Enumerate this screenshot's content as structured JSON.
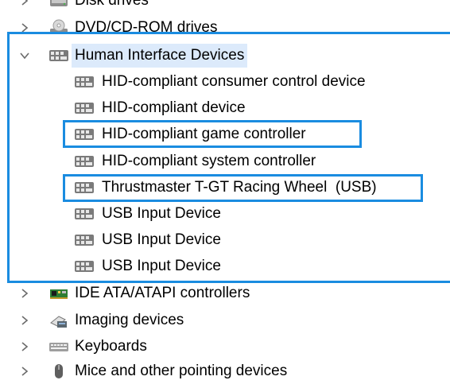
{
  "tree": {
    "items": [
      {
        "label": "Disk drives",
        "icon": "disk-drive-icon",
        "expanded": false
      },
      {
        "label": "DVD/CD-ROM drives",
        "icon": "dvd-drive-icon",
        "expanded": false
      },
      {
        "label": "Human Interface Devices",
        "icon": "hid-device-icon",
        "expanded": true,
        "selected": true
      },
      {
        "label": "HID-compliant consumer control device",
        "icon": "hid-device-icon"
      },
      {
        "label": "HID-compliant device",
        "icon": "hid-device-icon"
      },
      {
        "label": "HID-compliant game controller",
        "icon": "hid-device-icon",
        "highlighted": true
      },
      {
        "label": "HID-compliant system controller",
        "icon": "hid-device-icon"
      },
      {
        "label": "Thrustmaster T-GT Racing Wheel  (USB)",
        "icon": "hid-device-icon",
        "highlighted": true
      },
      {
        "label": "USB Input Device",
        "icon": "hid-device-icon"
      },
      {
        "label": "USB Input Device",
        "icon": "hid-device-icon"
      },
      {
        "label": "USB Input Device",
        "icon": "hid-device-icon"
      },
      {
        "label": "IDE ATA/ATAPI controllers",
        "icon": "ide-controller-icon",
        "expanded": false
      },
      {
        "label": "Imaging devices",
        "icon": "imaging-device-icon",
        "expanded": false
      },
      {
        "label": "Keyboards",
        "icon": "keyboard-icon",
        "expanded": false
      },
      {
        "label": "Mice and other pointing devices",
        "icon": "mouse-icon",
        "expanded": false
      }
    ]
  },
  "colors": {
    "highlight_border": "#1a8ce0",
    "selection_background": "#dceafb",
    "chevron": "#6b6b6b"
  }
}
